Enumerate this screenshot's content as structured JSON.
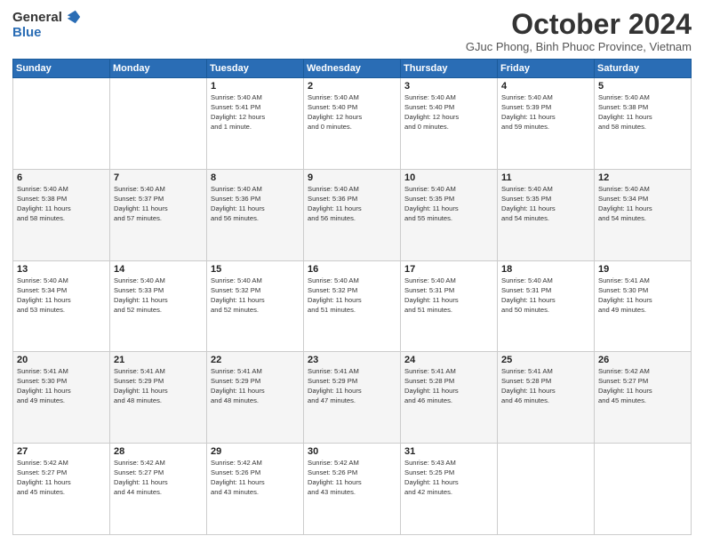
{
  "header": {
    "logo_general": "General",
    "logo_blue": "Blue",
    "month_title": "October 2024",
    "subtitle": "GJuc Phong, Binh Phuoc Province, Vietnam"
  },
  "days_of_week": [
    "Sunday",
    "Monday",
    "Tuesday",
    "Wednesday",
    "Thursday",
    "Friday",
    "Saturday"
  ],
  "weeks": [
    [
      {
        "day": "",
        "info": ""
      },
      {
        "day": "",
        "info": ""
      },
      {
        "day": "1",
        "info": "Sunrise: 5:40 AM\nSunset: 5:41 PM\nDaylight: 12 hours\nand 1 minute."
      },
      {
        "day": "2",
        "info": "Sunrise: 5:40 AM\nSunset: 5:40 PM\nDaylight: 12 hours\nand 0 minutes."
      },
      {
        "day": "3",
        "info": "Sunrise: 5:40 AM\nSunset: 5:40 PM\nDaylight: 12 hours\nand 0 minutes."
      },
      {
        "day": "4",
        "info": "Sunrise: 5:40 AM\nSunset: 5:39 PM\nDaylight: 11 hours\nand 59 minutes."
      },
      {
        "day": "5",
        "info": "Sunrise: 5:40 AM\nSunset: 5:38 PM\nDaylight: 11 hours\nand 58 minutes."
      }
    ],
    [
      {
        "day": "6",
        "info": "Sunrise: 5:40 AM\nSunset: 5:38 PM\nDaylight: 11 hours\nand 58 minutes."
      },
      {
        "day": "7",
        "info": "Sunrise: 5:40 AM\nSunset: 5:37 PM\nDaylight: 11 hours\nand 57 minutes."
      },
      {
        "day": "8",
        "info": "Sunrise: 5:40 AM\nSunset: 5:36 PM\nDaylight: 11 hours\nand 56 minutes."
      },
      {
        "day": "9",
        "info": "Sunrise: 5:40 AM\nSunset: 5:36 PM\nDaylight: 11 hours\nand 56 minutes."
      },
      {
        "day": "10",
        "info": "Sunrise: 5:40 AM\nSunset: 5:35 PM\nDaylight: 11 hours\nand 55 minutes."
      },
      {
        "day": "11",
        "info": "Sunrise: 5:40 AM\nSunset: 5:35 PM\nDaylight: 11 hours\nand 54 minutes."
      },
      {
        "day": "12",
        "info": "Sunrise: 5:40 AM\nSunset: 5:34 PM\nDaylight: 11 hours\nand 54 minutes."
      }
    ],
    [
      {
        "day": "13",
        "info": "Sunrise: 5:40 AM\nSunset: 5:34 PM\nDaylight: 11 hours\nand 53 minutes."
      },
      {
        "day": "14",
        "info": "Sunrise: 5:40 AM\nSunset: 5:33 PM\nDaylight: 11 hours\nand 52 minutes."
      },
      {
        "day": "15",
        "info": "Sunrise: 5:40 AM\nSunset: 5:32 PM\nDaylight: 11 hours\nand 52 minutes."
      },
      {
        "day": "16",
        "info": "Sunrise: 5:40 AM\nSunset: 5:32 PM\nDaylight: 11 hours\nand 51 minutes."
      },
      {
        "day": "17",
        "info": "Sunrise: 5:40 AM\nSunset: 5:31 PM\nDaylight: 11 hours\nand 51 minutes."
      },
      {
        "day": "18",
        "info": "Sunrise: 5:40 AM\nSunset: 5:31 PM\nDaylight: 11 hours\nand 50 minutes."
      },
      {
        "day": "19",
        "info": "Sunrise: 5:41 AM\nSunset: 5:30 PM\nDaylight: 11 hours\nand 49 minutes."
      }
    ],
    [
      {
        "day": "20",
        "info": "Sunrise: 5:41 AM\nSunset: 5:30 PM\nDaylight: 11 hours\nand 49 minutes."
      },
      {
        "day": "21",
        "info": "Sunrise: 5:41 AM\nSunset: 5:29 PM\nDaylight: 11 hours\nand 48 minutes."
      },
      {
        "day": "22",
        "info": "Sunrise: 5:41 AM\nSunset: 5:29 PM\nDaylight: 11 hours\nand 48 minutes."
      },
      {
        "day": "23",
        "info": "Sunrise: 5:41 AM\nSunset: 5:29 PM\nDaylight: 11 hours\nand 47 minutes."
      },
      {
        "day": "24",
        "info": "Sunrise: 5:41 AM\nSunset: 5:28 PM\nDaylight: 11 hours\nand 46 minutes."
      },
      {
        "day": "25",
        "info": "Sunrise: 5:41 AM\nSunset: 5:28 PM\nDaylight: 11 hours\nand 46 minutes."
      },
      {
        "day": "26",
        "info": "Sunrise: 5:42 AM\nSunset: 5:27 PM\nDaylight: 11 hours\nand 45 minutes."
      }
    ],
    [
      {
        "day": "27",
        "info": "Sunrise: 5:42 AM\nSunset: 5:27 PM\nDaylight: 11 hours\nand 45 minutes."
      },
      {
        "day": "28",
        "info": "Sunrise: 5:42 AM\nSunset: 5:27 PM\nDaylight: 11 hours\nand 44 minutes."
      },
      {
        "day": "29",
        "info": "Sunrise: 5:42 AM\nSunset: 5:26 PM\nDaylight: 11 hours\nand 43 minutes."
      },
      {
        "day": "30",
        "info": "Sunrise: 5:42 AM\nSunset: 5:26 PM\nDaylight: 11 hours\nand 43 minutes."
      },
      {
        "day": "31",
        "info": "Sunrise: 5:43 AM\nSunset: 5:25 PM\nDaylight: 11 hours\nand 42 minutes."
      },
      {
        "day": "",
        "info": ""
      },
      {
        "day": "",
        "info": ""
      }
    ]
  ]
}
